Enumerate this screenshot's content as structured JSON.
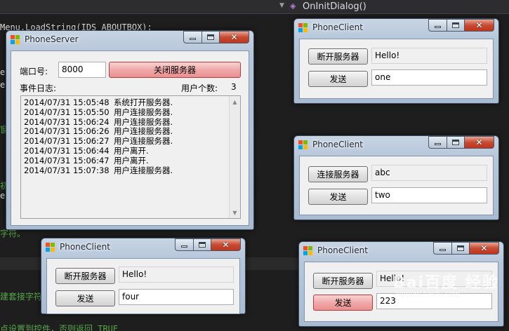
{
  "ide": {
    "method_dropdown": "OnInitDialog()",
    "code_lines": [
      "Menu.LoadString(IDS_ABOUTBOX);",
      "e",
      "e",
      "窗",
      "初",
      "e",
      "字符。",
      "建套接字符",
      "点设置到控件，否则返回 TRUE"
    ]
  },
  "server": {
    "title": "PhoneServer",
    "port_label": "端口号:",
    "port_value": "8000",
    "toggle_button": "关闭服务器",
    "log_label": "事件日志:",
    "user_count_label": "用户个数:",
    "user_count": "3",
    "log": [
      {
        "time": "2014/07/31 15:05:48",
        "msg": "系统打开服务器."
      },
      {
        "time": "2014/07/31 15:05:50",
        "msg": "用户连接服务器."
      },
      {
        "time": "2014/07/31 15:06:24",
        "msg": "用户连接服务器."
      },
      {
        "time": "2014/07/31 15:06:26",
        "msg": "用户连接服务器."
      },
      {
        "time": "2014/07/31 15:06:27",
        "msg": "用户连接服务器."
      },
      {
        "time": "2014/07/31 15:06:44",
        "msg": "用户离开."
      },
      {
        "time": "2014/07/31 15:06:47",
        "msg": "用户离开."
      },
      {
        "time": "2014/07/31 15:07:38",
        "msg": "用户连接服务器."
      }
    ]
  },
  "clients": [
    {
      "title": "PhoneClient",
      "connect_button": "断开服务器",
      "received": "Hello!",
      "send_button": "发送",
      "input": "one"
    },
    {
      "title": "PhoneClient",
      "connect_button": "连接服务器",
      "received": "abc",
      "send_button": "发送",
      "input": "two"
    },
    {
      "title": "PhoneClient",
      "connect_button": "断开服务器",
      "received": "Hello!",
      "send_button": "发送",
      "input": "four"
    },
    {
      "title": "PhoneClient",
      "connect_button": "断开服务器",
      "received": "Hello!",
      "send_button": "发送",
      "input": "223"
    }
  ],
  "watermark": {
    "text": "Bai百度 经验",
    "url": "jingyan.baidu.com"
  }
}
